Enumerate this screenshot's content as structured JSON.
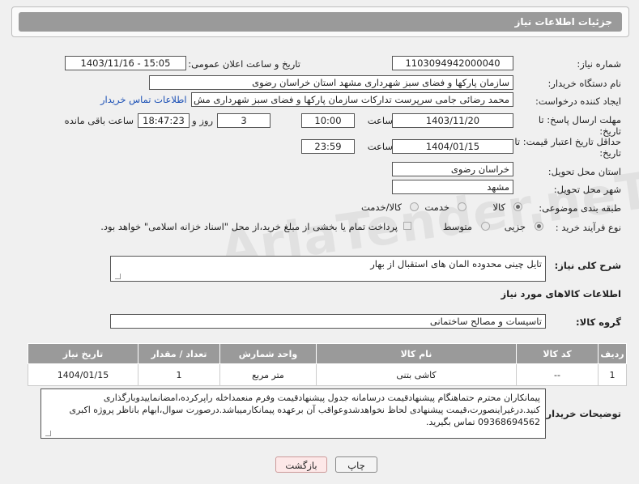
{
  "header": {
    "title": "جزئیات اطلاعات نیاز"
  },
  "fields": {
    "need_number_label": "شماره نیاز:",
    "need_number": "1103094942000040",
    "announce_label": "تاریخ و ساعت اعلان عمومی:",
    "announce_value": "1403/11/16 - 15:05",
    "buyer_org_label": "نام دستگاه خریدار:",
    "buyer_org": "سازمان پارکها و فضای سبز شهرداری مشهد استان خراسان رضوی",
    "creator_label": "ایجاد کننده درخواست:",
    "creator": "محمد رضائی جامی سرپرست تدارکات سازمان پارکها و فضای سبز شهرداری مش",
    "contact_link": "اطلاعات تماس خریدار",
    "deadline_label": "مهلت ارسال پاسخ: تا تاریخ:",
    "deadline_date": "1403/11/20",
    "time_label": "ساعت",
    "deadline_time": "10:00",
    "days_value": "3",
    "days_label": "روز و",
    "remaining_time": "18:47:23",
    "remaining_label": "ساعت باقی مانده",
    "min_validity_label": "حداقل تاریخ اعتبار قیمت: تا تاریخ:",
    "validity_date": "1404/01/15",
    "validity_time_label": "ساعت",
    "validity_time": "23:59",
    "province_label": "استان محل تحویل:",
    "province": "خراسان رضوی",
    "city_label": "شهر محل تحویل:",
    "city": "مشهد",
    "category_label": "طبقه بندی موضوعی:",
    "category_options": [
      "کالا",
      "خدمت",
      "کالا/خدمت"
    ],
    "process_label": "نوع فرآیند خرید :",
    "process_options": [
      "جزیی",
      "متوسط"
    ],
    "payment_note": "پرداخت تمام یا بخشی از مبلغ خرید،از محل \"اسناد خزانه اسلامی\" خواهد بود."
  },
  "description": {
    "label": "شرح کلی نیاز:",
    "value": "تایل چینی محدوده المان های استقبال از بهار"
  },
  "goods_section_title": "اطلاعات کالاهای مورد نیاز",
  "goods_group": {
    "label": "گروه کالا:",
    "value": "تاسیسات و مصالح ساختمانی"
  },
  "table": {
    "headers": [
      "ردیف",
      "کد کالا",
      "نام کالا",
      "واحد شمارش",
      "تعداد / مقدار",
      "تاریخ نیاز"
    ],
    "rows": [
      [
        "1",
        "--",
        "کاشی بتنی",
        "متر مربع",
        "1",
        "1404/01/15"
      ]
    ]
  },
  "buyer_notes": {
    "label": "توضیحات خریدار:",
    "value": "پیمانکاران محترم حتماهنگام پیشنهادقیمت درسامانه جدول پیشنهادقیمت وفرم منعمداخله راپرکرده،امضانماییدوبارگذاری کنید.درغیراینصورت،قیمت پیشنهادی لحاظ نخواهدشدوعواقب آن برعهده پیمانکارمیباشد.درصورت سوال،ابهام باناظر پروژه اکبری 09368694562 تماس بگیرید."
  },
  "buttons": {
    "print": "چاپ",
    "back": "بازگشت"
  },
  "watermark": "AriaTender.neT",
  "colors": {
    "header_bg": "#9a9a9a",
    "link": "#1a4fb5",
    "back_button_bg": "#fde8e8"
  }
}
